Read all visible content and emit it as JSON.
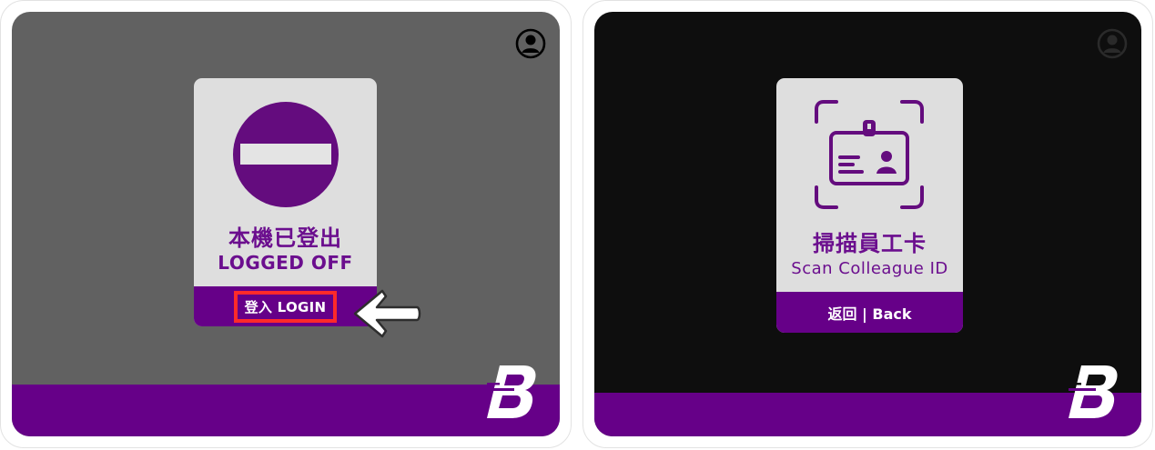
{
  "left_screen": {
    "status_zh": "本機已登出",
    "status_en": "LOGGED OFF",
    "login_label": "登入 LOGIN"
  },
  "right_screen": {
    "prompt_zh": "掃描員工卡",
    "prompt_en": "Scan Colleague ID",
    "back_label": "返回 | Back"
  },
  "colors": {
    "brand_purple": "#660088",
    "card_bg": "#dedede",
    "left_bg": "#616161",
    "right_bg": "#0e0e0e",
    "highlight": "#ff2a2a"
  },
  "icons": [
    "user-account-icon",
    "no-entry-icon",
    "id-card-scan-icon",
    "brand-logo",
    "pointer-arrow-icon"
  ]
}
